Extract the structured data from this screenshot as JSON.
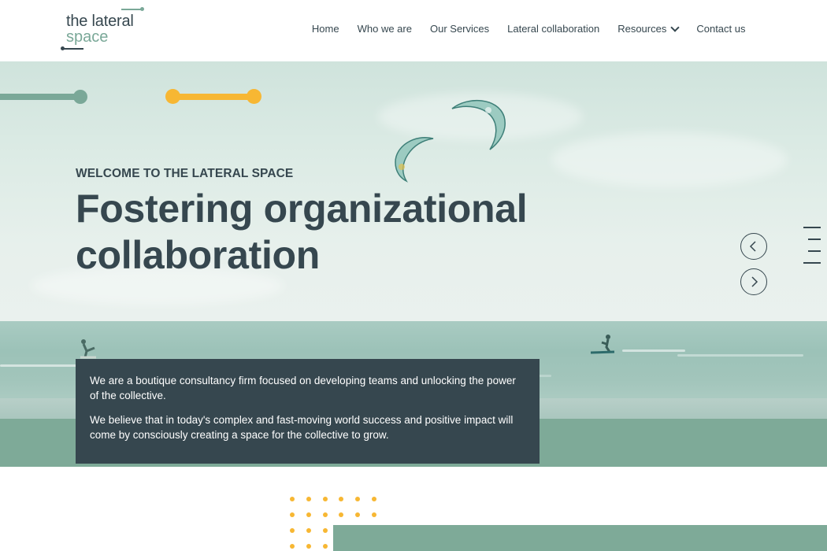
{
  "brand": {
    "line1": "the lateral",
    "line2": "space"
  },
  "nav": {
    "items": [
      "Home",
      "Who we are",
      "Our Services",
      "Lateral collaboration",
      "Resources",
      "Contact us"
    ],
    "dropdown_item": "Resources"
  },
  "hero": {
    "kicker": "WELCOME TO THE LATERAL SPACE",
    "headline": "Fostering organizational collaboration",
    "paragraph1": "We are a boutique consultancy firm focused on developing teams and unlocking the power of the collective.",
    "paragraph2": "We believe that in today's complex and fast-moving world success and positive impact will come by consciously creating a space for the collective to grow."
  },
  "colors": {
    "primary_dark": "#36474f",
    "accent_green": "#7eaa98",
    "accent_yellow": "#f7b733"
  },
  "icons": [
    "chevron-down-icon",
    "arrow-left-icon",
    "arrow-right-icon",
    "slide-nav-icon"
  ]
}
